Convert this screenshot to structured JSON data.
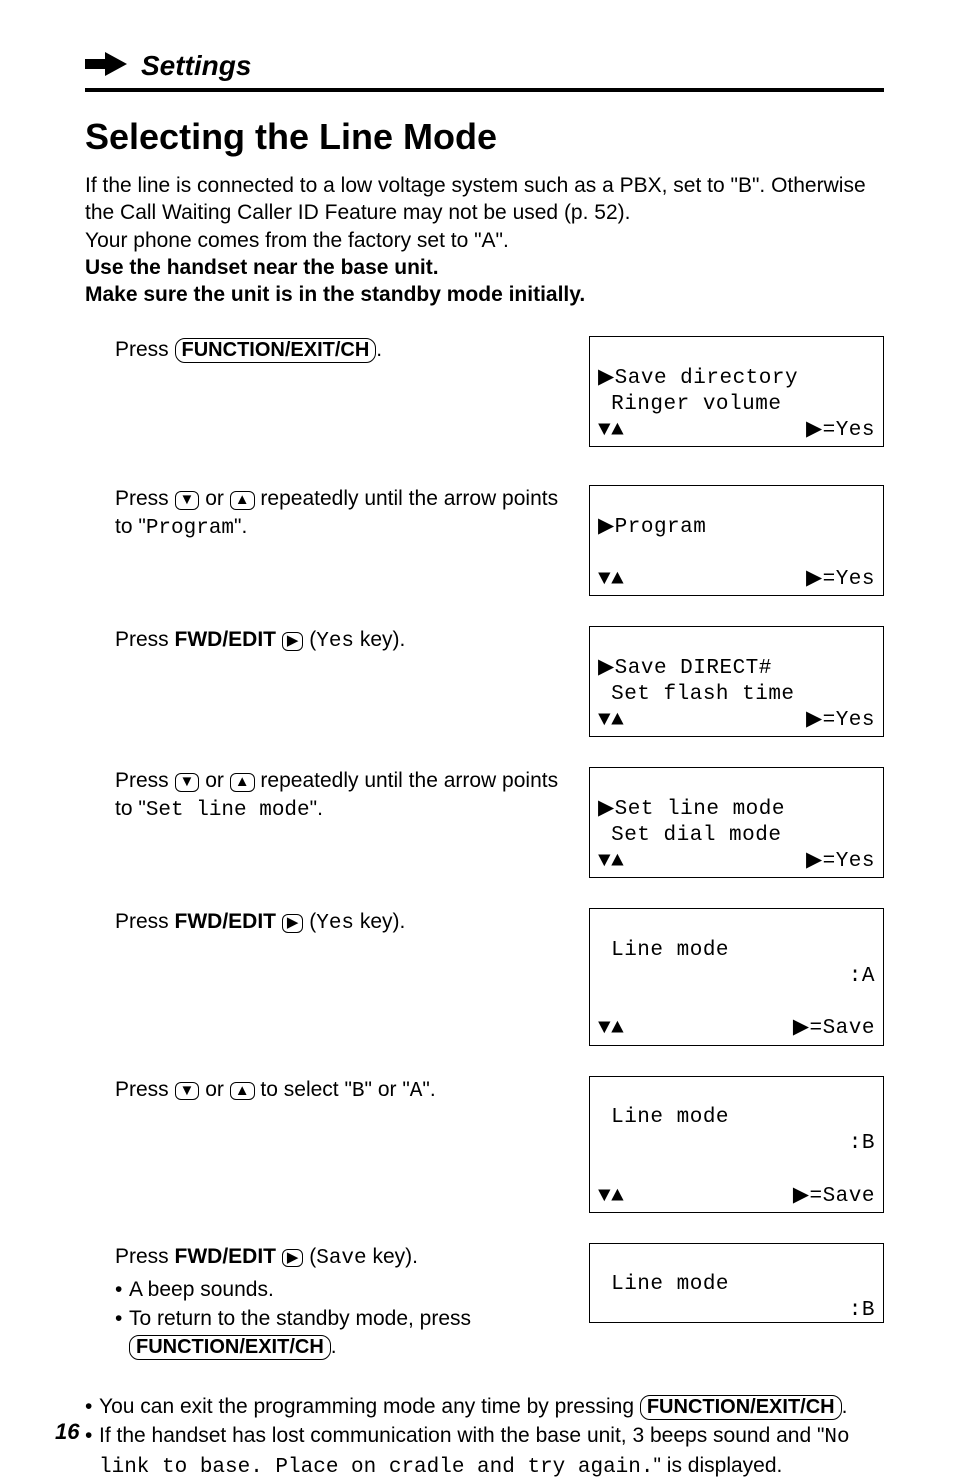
{
  "section_title": "Settings",
  "heading": "Selecting the Line Mode",
  "intro_plain_1": "If the line is connected to a low voltage system such as a PBX, set to \"B\". Otherwise the Call Waiting Caller ID Feature may not be used (p. 52).",
  "intro_plain_2": "Your phone comes from the factory set to \"A\".",
  "intro_bold_1": "Use the handset near the base unit.",
  "intro_bold_2": "Make sure the unit is in the standby mode initially.",
  "fn_key": "FUNCTION/EXIT/CH",
  "fwd_label_pre": "FWD/EDIT",
  "yes_key_suffix": "Yes",
  "save_key_suffix": "Save",
  "steps": {
    "s1_pre": "Press ",
    "s1_post": ".",
    "s2_a": "Press ",
    "s2_b": " or ",
    "s2_c": " repeatedly until the arrow points to \"",
    "s2_mono": "Program",
    "s2_d": "\".",
    "s3_a": "Press ",
    "s3_c": " (",
    "s3_d": " key).",
    "s4_a": "Press ",
    "s4_b": " or ",
    "s4_c": " repeatedly until the arrow points to \"",
    "s4_mono": "Set line mode",
    "s4_d": "\".",
    "s5_a": "Press ",
    "s5_c": " (",
    "s5_d": " key).",
    "s6_a": "Press ",
    "s6_b": " or ",
    "s6_c": " to select \"",
    "s6_m1": "B",
    "s6_d": "\" or \"",
    "s6_m2": "A",
    "s6_e": "\".",
    "s7_a": "Press ",
    "s7_c": " (",
    "s7_d": " key).",
    "s7_bullet1": "A beep sounds.",
    "s7_bullet2_a": "To return to the standby mode, press ",
    "s7_bullet2_b": "."
  },
  "lcd": {
    "d1_l1": "▶Save directory",
    "d1_l2": " Ringer volume",
    "d1_nav_l": "▼▲",
    "d1_nav_r": "▶=Yes",
    "d2_l1": "▶Program",
    "d2_l2": " ",
    "d2_nav_l": "▼▲",
    "d2_nav_r": "▶=Yes",
    "d3_l1": "▶Save DIRECT#",
    "d3_l2": " Set flash time",
    "d3_nav_l": "▼▲",
    "d3_nav_r": "▶=Yes",
    "d4_l1": "▶Set line mode",
    "d4_l2": " Set dial mode",
    "d4_nav_l": "▼▲",
    "d4_nav_r": "▶=Yes",
    "d5_l1": " Line mode",
    "d5_l2r": ":A",
    "d5_nav_l": "▼▲",
    "d5_nav_r": "▶=Save",
    "d6_l1": " Line mode",
    "d6_l2r": ":B",
    "d6_nav_l": "▼▲",
    "d6_nav_r": "▶=Save",
    "d7_l1": " Line mode",
    "d7_l2r": ":B"
  },
  "notes": {
    "n1_a": "You can exit the programming mode any time by pressing ",
    "n1_b": ".",
    "n2_a": "If the handset has lost communication with the base unit, 3 beeps sound and \"",
    "n2_mono": "No link to base. Place on cradle and try again.",
    "n2_b": "\" is displayed."
  },
  "page_number": "16"
}
